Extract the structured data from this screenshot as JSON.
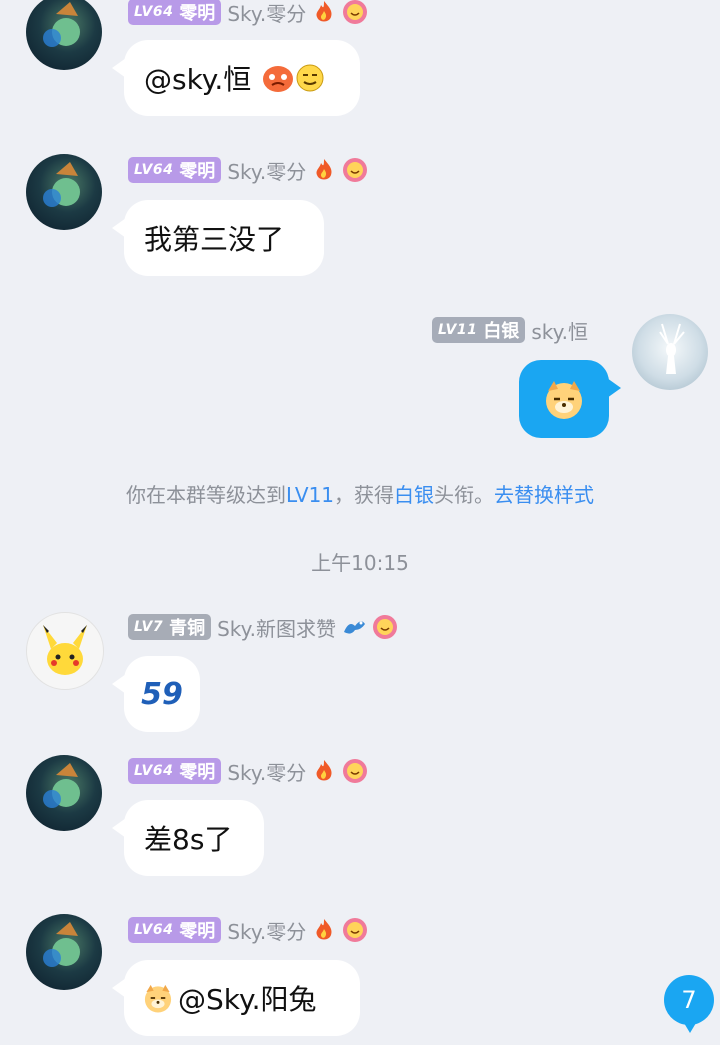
{
  "messages": [
    {
      "level": "LV64",
      "title": "零明",
      "nickname": "Sky.零分",
      "content": "@sky.恒"
    },
    {
      "level": "LV64",
      "title": "零明",
      "nickname": "Sky.零分",
      "content": "我第三没了"
    },
    {
      "level": "LV11",
      "title": "白银",
      "nickname": "sky.恒",
      "content_icon": "doge-sticker"
    },
    {
      "level": "LV7",
      "title": "青铜",
      "nickname": "Sky.新图求赞",
      "content": "59"
    },
    {
      "level": "LV64",
      "title": "零明",
      "nickname": "Sky.零分",
      "content": "差8s了"
    },
    {
      "level": "LV64",
      "title": "零明",
      "nickname": "Sky.零分",
      "content": "@Sky.阳兔"
    }
  ],
  "system_notice": {
    "prefix": "你在本群等级达到",
    "level": "LV11",
    "middle": "，获得",
    "title": "白银",
    "suffix": "头衔。",
    "action": "去替换样式"
  },
  "timestamp": "上午10:15",
  "unread_count": "7",
  "colors": {
    "background": "#eef0f5",
    "self_bubble": "#1aa6f2",
    "badge_purple": "#b89ae8",
    "badge_grey": "#a6acb8",
    "link": "#3a8ef0"
  }
}
